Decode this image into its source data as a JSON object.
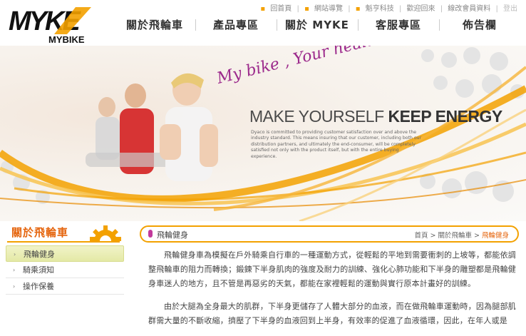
{
  "brand": {
    "logo_text": "MYKE",
    "logo_sub": "MYBIKE"
  },
  "util_links": [
    "回首頁",
    "網站導覽",
    "魁亨科技",
    "歡迎回來",
    "線改會員資料",
    "登出"
  ],
  "nav": [
    "關於飛輪車",
    "產品專區",
    "關於 MYKE",
    "客服專區",
    "佈告欄"
  ],
  "banner": {
    "script_text": "My bike , Your health",
    "slogan_part1": "MAKE YOURSELF ",
    "slogan_part2": "KEEP ENERGY",
    "description": "Dyaco is committed to providing customer satisfaction over and above the industry standard. This means insuring that our customer, including both our distribution partners, and ultimately the end-consumer, will be completely satisfied not only with the product itself, but with the entire buying experience."
  },
  "sidebar": {
    "title": "關於飛輪車",
    "items": [
      {
        "label": "飛輪健身",
        "active": true
      },
      {
        "label": "騎乘須知",
        "active": false
      },
      {
        "label": "操作保養",
        "active": false
      }
    ]
  },
  "content": {
    "section_title": "飛輪健身",
    "breadcrumb": {
      "home": "首頁",
      "sep": " > ",
      "parent": "關於飛輪車",
      "current": "飛輪健身"
    },
    "paragraphs": [
      "飛輪健身車為模擬在戶外騎乘自行車的一種運動方式，從輕鬆的平地到需要衝刺的上坡等，都能依調整飛輪車的阻力而轉換；鍛鍊下半身肌肉的強度及耐力的訓練、強化心肺功能和下半身的雕塑都是飛輪健身車迷人的地方，且不管是再惡劣的天氣，都能在家裡輕鬆的運動與實行原本計畫好的訓練。",
      "由於大腿為全身最大的肌群，下半身更儲存了人體大部分的血液，而在做飛輪車運動時，因為腿部肌群需大量的不斷收縮，擠壓了下半身的血液回到上半身，有效率的促進了血液循環，因此，在年人或是"
    ]
  },
  "colors": {
    "accent_orange": "#f3a100",
    "title_orange": "#e5650e",
    "script_purple": "#9c2a8c",
    "active_green": "#e4e9a6"
  }
}
